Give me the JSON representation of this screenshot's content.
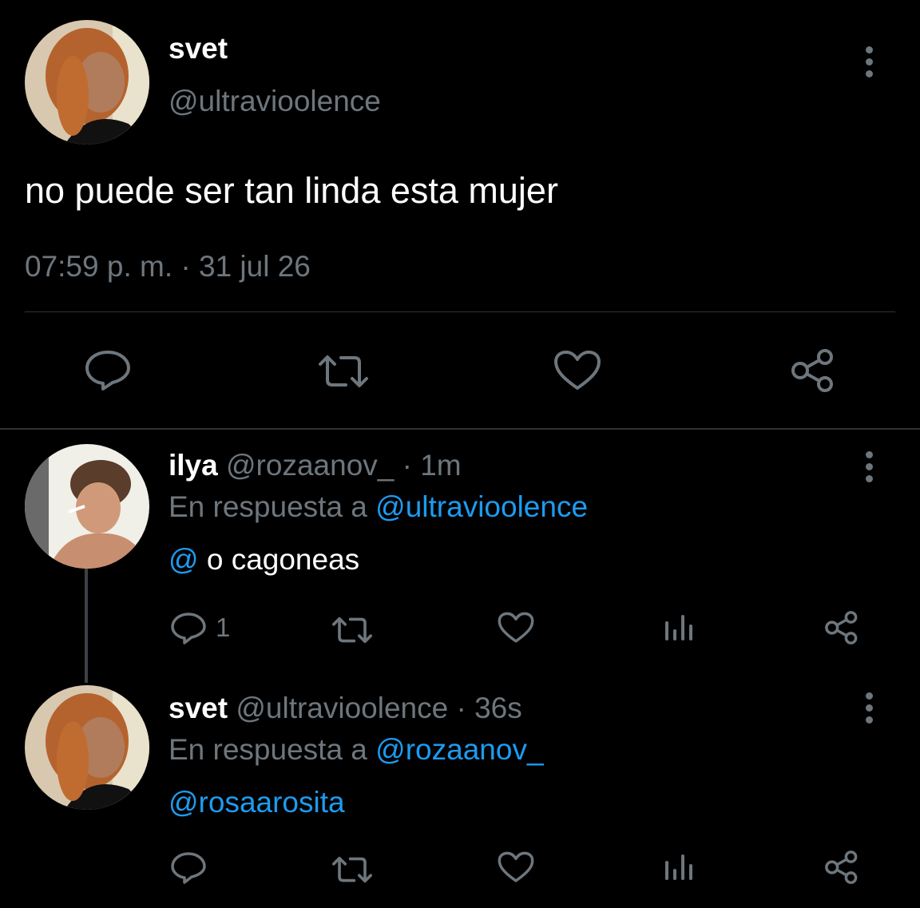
{
  "main_tweet": {
    "name": "svet",
    "handle": "@ultravioolence",
    "text": "no puede ser tan linda esta mujer",
    "timestamp": "07:59 p. m. · 31 jul 26"
  },
  "reply1": {
    "name": "ilya",
    "handle_time": "@rozaanov_ · 1m",
    "reply_prefix": "En respuesta a",
    "reply_to": "@ultravioolence",
    "text_mention": "@",
    "text_rest": "o cagoneas",
    "reply_count": "1"
  },
  "reply2": {
    "name": "svet",
    "handle_time": "@ultravioolence · 36s",
    "reply_prefix": "En respuesta a",
    "reply_to": "@rozaanov_",
    "text_mention": "@rosaarosita"
  },
  "colors": {
    "muted": "#6e767d",
    "link": "#1d9bf0",
    "background": "#000000"
  },
  "icons": [
    "reply-icon",
    "retweet-icon",
    "like-icon",
    "share-icon",
    "views-icon",
    "more-icon"
  ]
}
